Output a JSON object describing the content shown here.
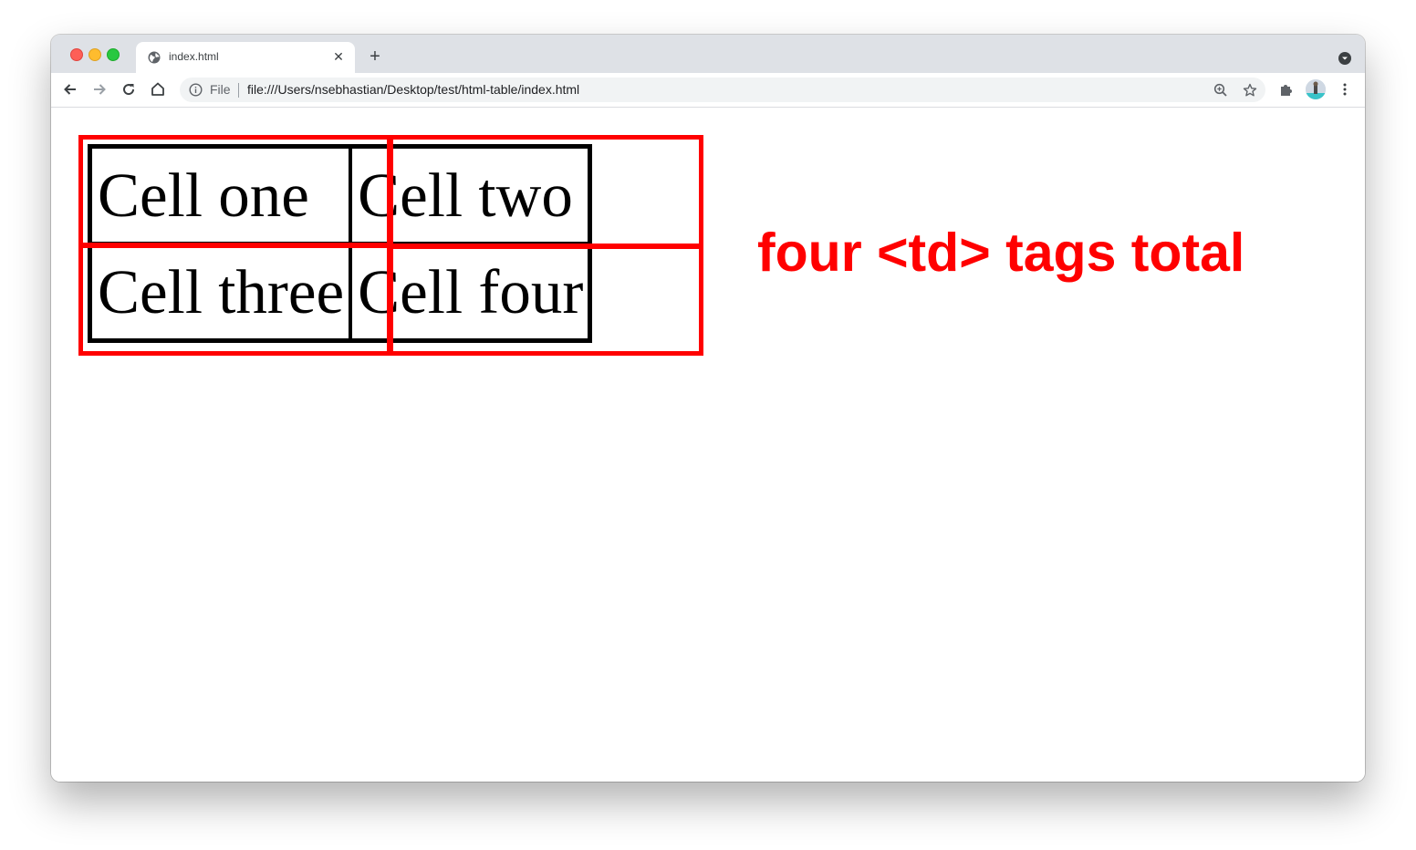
{
  "tab": {
    "title": "index.html"
  },
  "toolbar": {
    "scheme_label": "File",
    "url": "file:///Users/nsebhastian/Desktop/test/html-table/index.html"
  },
  "page": {
    "table": {
      "rows": [
        [
          "Cell one",
          "Cell two"
        ],
        [
          "Cell three",
          "Cell four"
        ]
      ]
    },
    "annotation": "four <td> tags total"
  },
  "colors": {
    "highlight": "#ff0000",
    "tabstrip_bg": "#dee1e6"
  },
  "icons": [
    "globe-icon",
    "close-icon",
    "plus-icon",
    "tab-search-icon",
    "back-arrow-icon",
    "forward-arrow-icon",
    "reload-icon",
    "home-icon",
    "info-icon",
    "zoom-icon",
    "star-icon",
    "puzzle-icon",
    "avatar",
    "more-vert-icon"
  ]
}
